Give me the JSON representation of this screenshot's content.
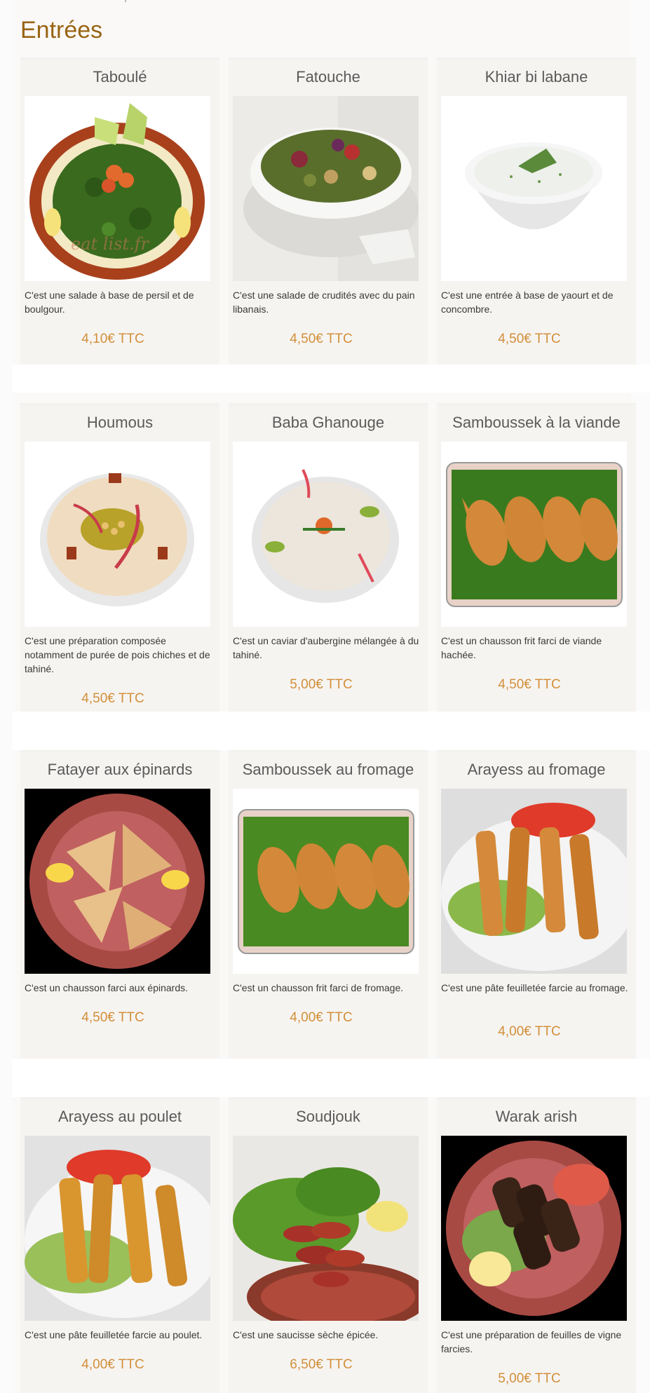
{
  "section": {
    "title": "Entrées"
  },
  "rows": [
    {
      "cards": [
        {
          "name": "Taboulé",
          "desc": "C'est une salade à base de persil et de boulgour.",
          "price": "4,10€ TTC",
          "icon": "tabbouleh-photo",
          "watermark": "eat list.fr"
        },
        {
          "name": "Fatouche",
          "desc": "C'est une salade de crudités avec du pain libanais.",
          "price": "4,50€ TTC",
          "icon": "fattoush-photo"
        },
        {
          "name": "Khiar bi labane",
          "desc": "C'est une entrée à base de yaourt et de concombre.",
          "price": "4,50€ TTC",
          "icon": "yogurt-cucumber-photo"
        }
      ]
    },
    {
      "cards": [
        {
          "name": "Houmous",
          "desc": "C'est une préparation composée notamment de purée de pois chiches et de tahiné.",
          "price": "4,50€ TTC",
          "icon": "hummus-photo"
        },
        {
          "name": "Baba Ghanouge",
          "desc": "C'est un caviar d'aubergine mélangée à du tahiné.",
          "price": "5,00€ TTC",
          "icon": "baba-ghanoush-photo"
        },
        {
          "name": "Samboussek à la viande",
          "desc": "C'est un chausson frit farci de viande hachée.",
          "price": "4,50€ TTC",
          "icon": "meat-samboussek-photo"
        }
      ]
    },
    {
      "cards": [
        {
          "name": "Fatayer aux épinards",
          "desc": "C'est un chausson farci aux épinards.",
          "price": "4,50€ TTC",
          "icon": "spinach-fatayer-photo"
        },
        {
          "name": "Samboussek au fromage",
          "desc": "C'est un chausson frit farci de fromage.",
          "price": "4,00€ TTC",
          "icon": "cheese-samboussek-photo"
        },
        {
          "name": "Arayess au fromage",
          "desc": "C'est une pâte feuilletée farcie au fromage.",
          "price": "4,00€ TTC",
          "icon": "cheese-rolls-photo"
        }
      ]
    },
    {
      "cards": [
        {
          "name": "Arayess au poulet",
          "desc": "C'est une pâte feuilletée farcie au poulet.",
          "price": "4,00€ TTC",
          "icon": "chicken-rolls-photo"
        },
        {
          "name": "Soudjouk",
          "desc": "C'est une saucisse sèche épicée.",
          "price": "6,50€ TTC",
          "icon": "sujuk-photo"
        },
        {
          "name": "Warak arish",
          "desc": "C'est une préparation de feuilles de vigne farcies.",
          "price": "5,00€ TTC",
          "icon": "stuffed-vine-leaves-photo"
        }
      ]
    }
  ],
  "colors": {
    "title": "#9a6414",
    "price": "#d28f3a",
    "card_bg": "#f6f4f1",
    "text": "#3a3a3a"
  }
}
